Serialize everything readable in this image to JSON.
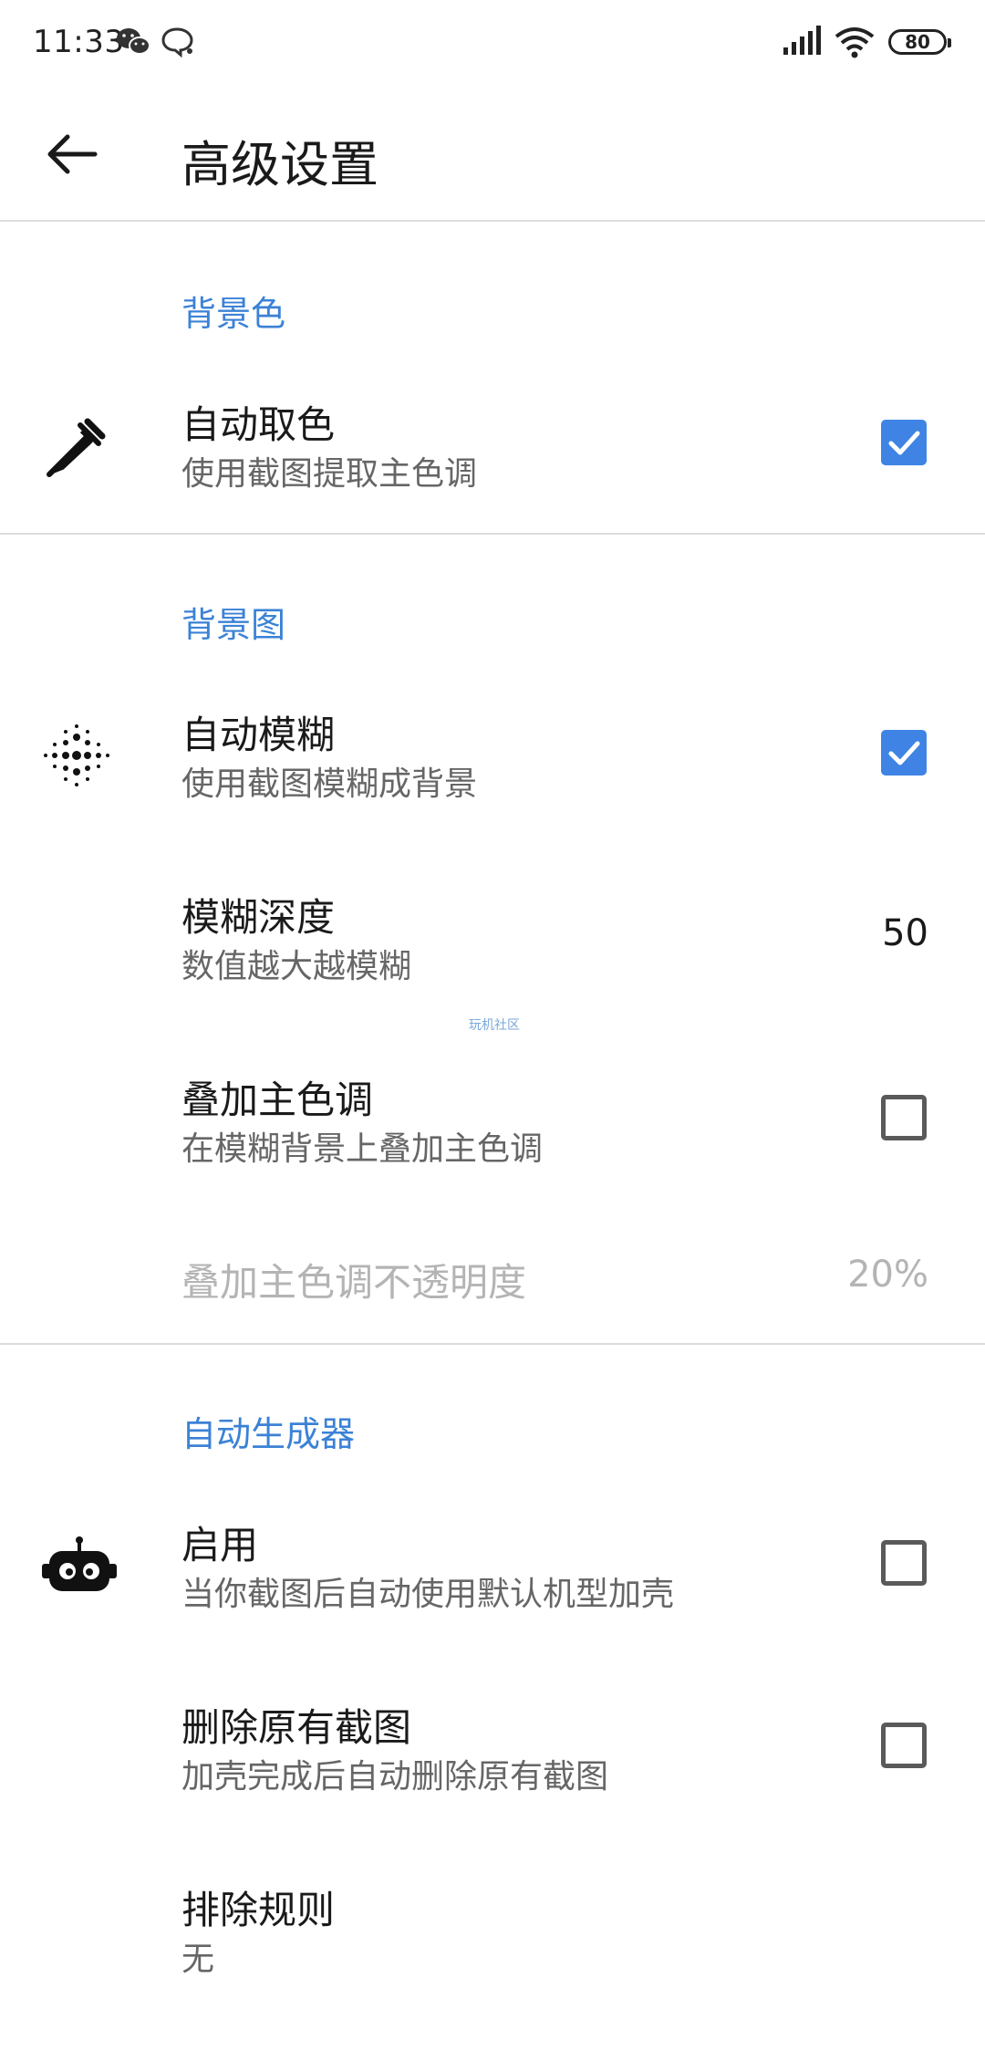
{
  "status_bar": {
    "time": "11:33",
    "battery": "80",
    "icons": [
      "wechat-icon",
      "chat-bubble-icon",
      "signal-icon",
      "wifi-icon"
    ]
  },
  "toolbar": {
    "title": "高级设置",
    "back_icon": "arrow-left-icon"
  },
  "sections": {
    "background_color": {
      "header": "背景色",
      "auto_color": {
        "title": "自动取色",
        "subtitle": "使用截图提取主色调",
        "checked": true,
        "icon": "eyedropper-icon"
      }
    },
    "background_image": {
      "header": "背景图",
      "auto_blur": {
        "title": "自动模糊",
        "subtitle": "使用截图模糊成背景",
        "checked": true,
        "icon": "blur-dots-icon"
      },
      "blur_depth": {
        "title": "模糊深度",
        "subtitle": "数值越大越模糊",
        "value": "50"
      },
      "overlay_color": {
        "title": "叠加主色调",
        "subtitle": "在模糊背景上叠加主色调",
        "checked": false
      },
      "overlay_opacity": {
        "title": "叠加主色调不透明度",
        "value": "20%",
        "enabled": false
      }
    },
    "auto_generator": {
      "header": "自动生成器",
      "enable": {
        "title": "启用",
        "subtitle": "当你截图后自动使用默认机型加壳",
        "checked": false,
        "icon": "robot-icon"
      },
      "delete_original": {
        "title": "删除原有截图",
        "subtitle": "加壳完成后自动删除原有截图",
        "checked": false
      },
      "exclude_rules": {
        "title": "排除规则",
        "subtitle": "无"
      }
    }
  },
  "watermark": "玩机社区",
  "colors": {
    "accent": "#3f84e5",
    "section_header": "#3b82d6",
    "divider": "#dcdcdc",
    "disabled_text": "#b4b4b4"
  }
}
